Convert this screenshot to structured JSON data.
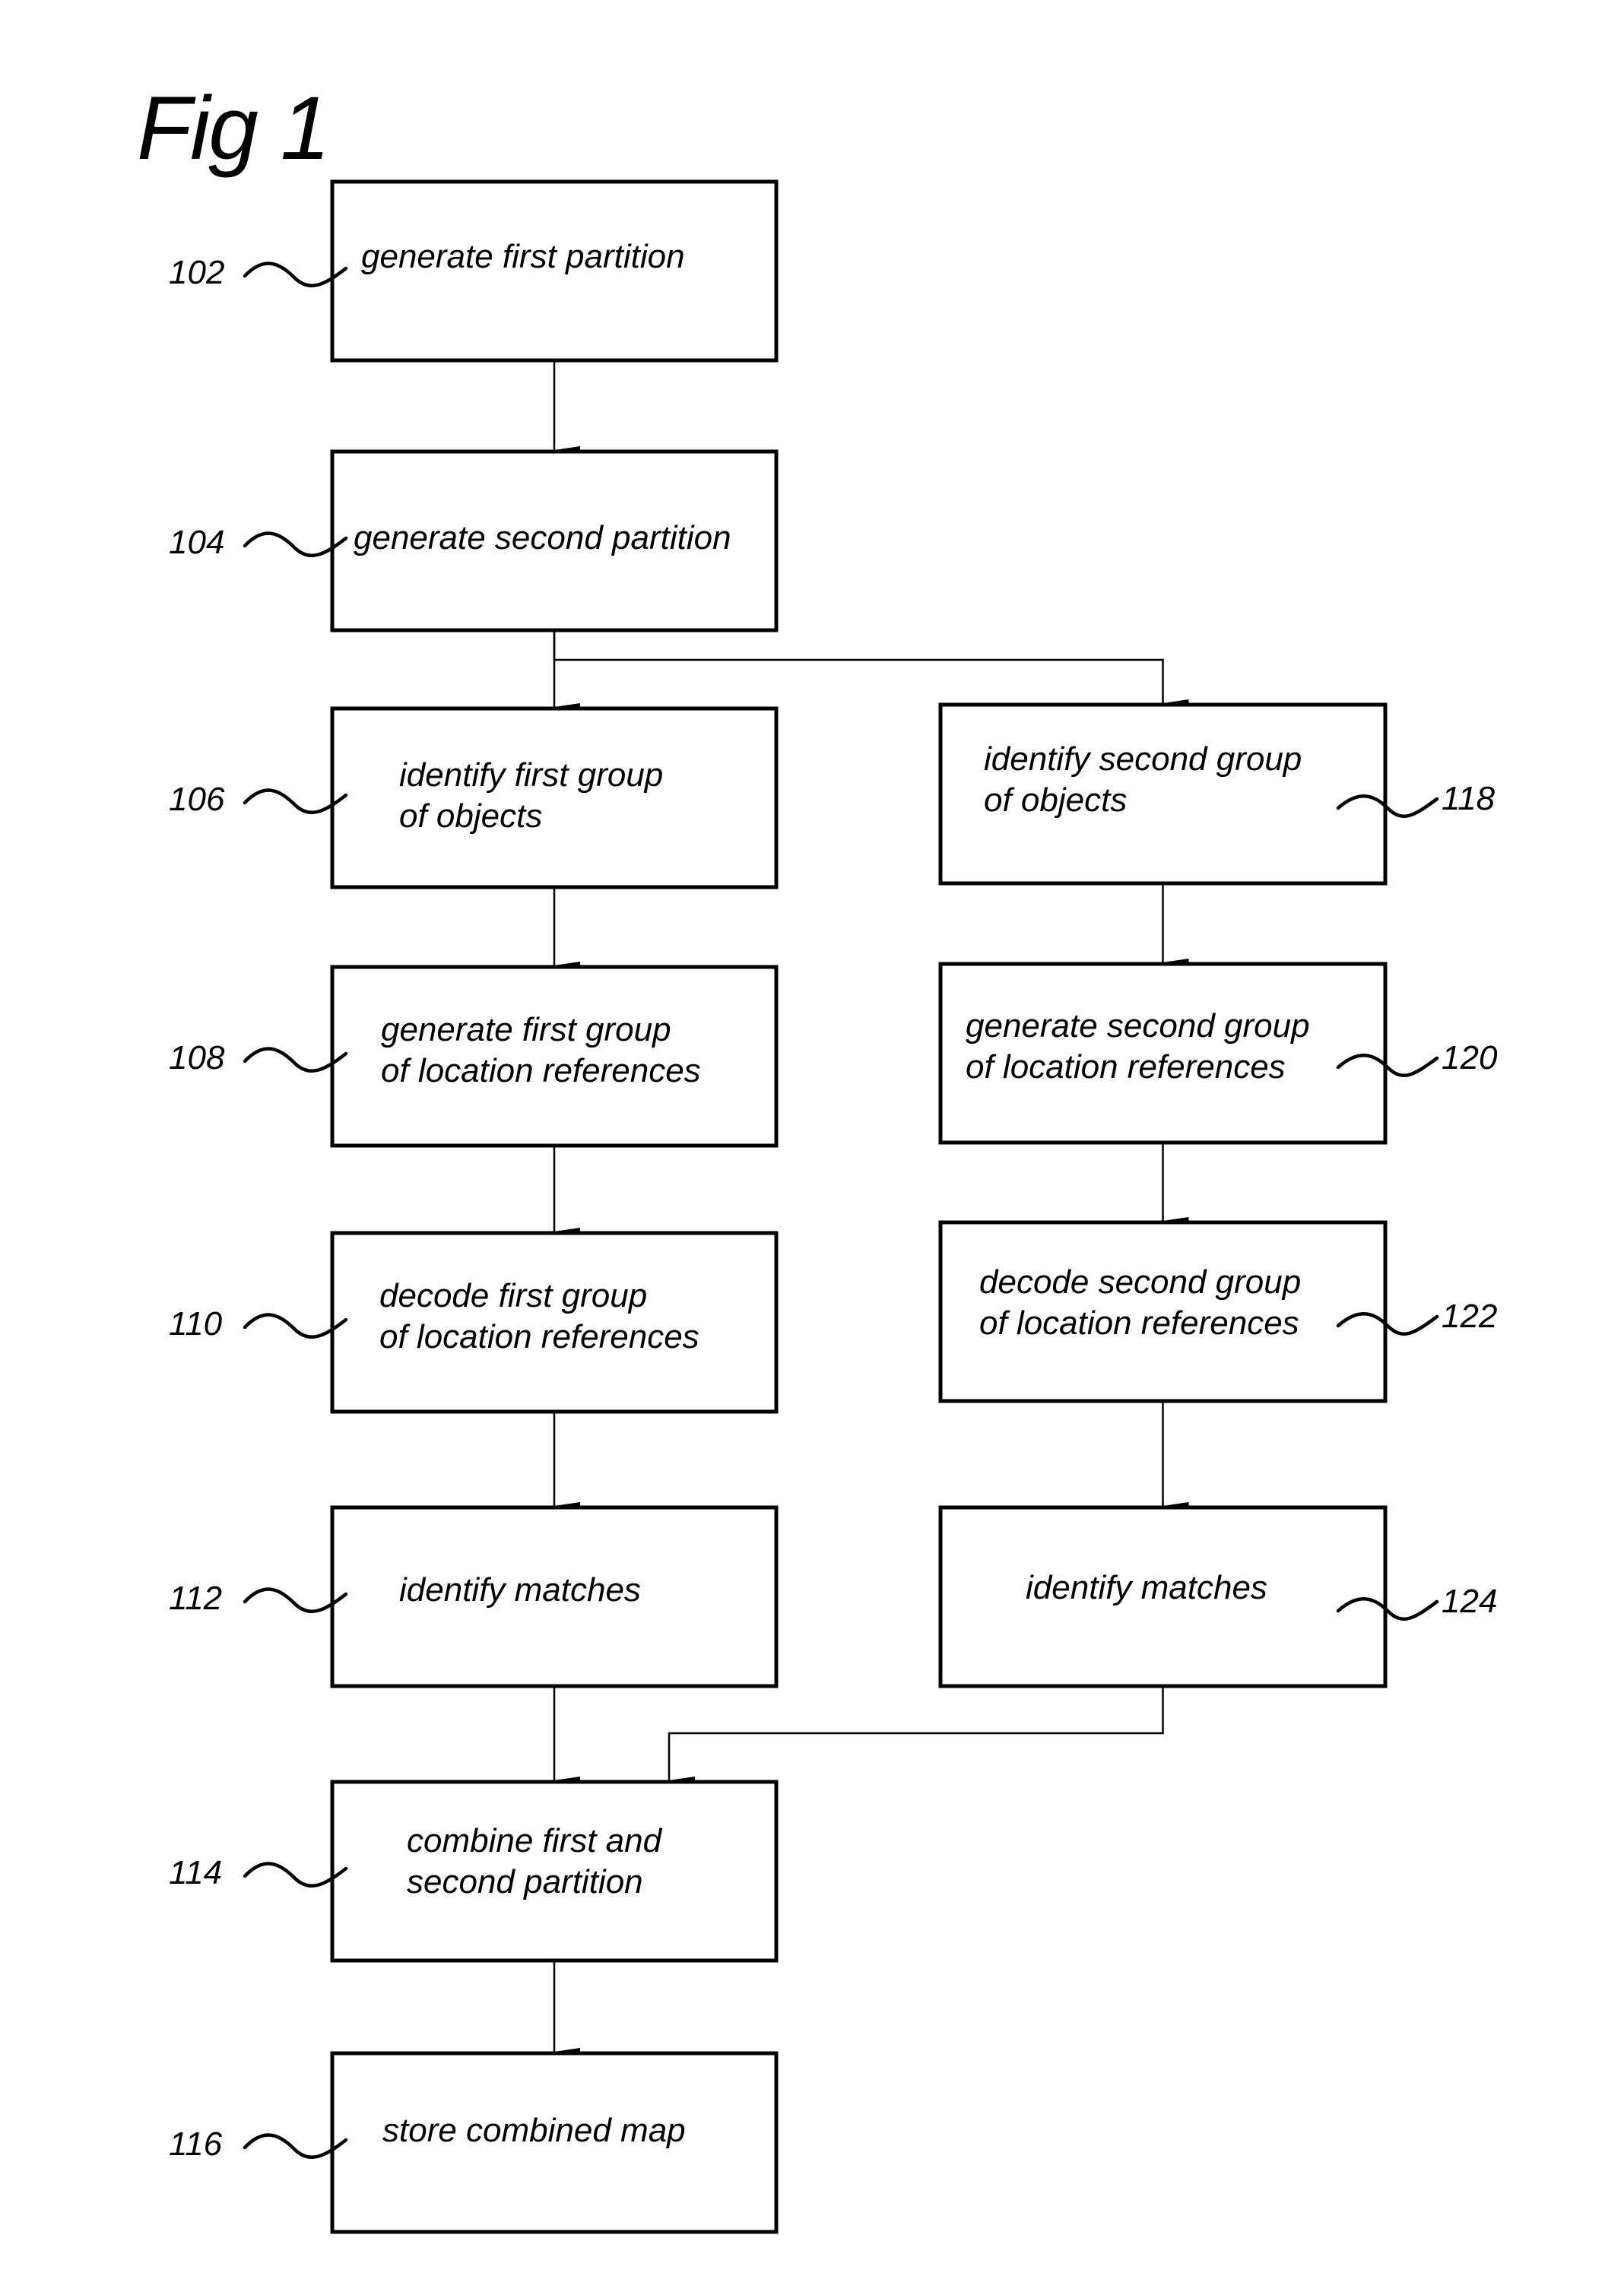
{
  "figure": {
    "title": "Fig 1"
  },
  "steps": [
    {
      "ref": "102",
      "lines": [
        "generate first partition"
      ],
      "column": "left"
    },
    {
      "ref": "104",
      "lines": [
        "generate second partition"
      ],
      "column": "left"
    },
    {
      "ref": "106",
      "lines": [
        "identify first group",
        "of objects"
      ],
      "column": "left"
    },
    {
      "ref": "108",
      "lines": [
        "generate first group",
        "of location references"
      ],
      "column": "left"
    },
    {
      "ref": "110",
      "lines": [
        "decode first group",
        "of location references"
      ],
      "column": "left"
    },
    {
      "ref": "112",
      "lines": [
        "identify matches"
      ],
      "column": "left"
    },
    {
      "ref": "114",
      "lines": [
        "combine first and",
        "second partition"
      ],
      "column": "left"
    },
    {
      "ref": "116",
      "lines": [
        "store combined map"
      ],
      "column": "left"
    },
    {
      "ref": "118",
      "lines": [
        "identify second group",
        "of objects"
      ],
      "column": "right"
    },
    {
      "ref": "120",
      "lines": [
        "generate second group",
        "of location references"
      ],
      "column": "right"
    },
    {
      "ref": "122",
      "lines": [
        "decode second group",
        "of location references"
      ],
      "column": "right"
    },
    {
      "ref": "124",
      "lines": [
        "identify matches"
      ],
      "column": "right"
    }
  ],
  "connections": [
    {
      "from": "102",
      "to": "104"
    },
    {
      "from": "104",
      "to": "106"
    },
    {
      "from": "104",
      "to": "118"
    },
    {
      "from": "106",
      "to": "108"
    },
    {
      "from": "108",
      "to": "110"
    },
    {
      "from": "110",
      "to": "112"
    },
    {
      "from": "112",
      "to": "114"
    },
    {
      "from": "114",
      "to": "116"
    },
    {
      "from": "118",
      "to": "120"
    },
    {
      "from": "120",
      "to": "122"
    },
    {
      "from": "122",
      "to": "124"
    },
    {
      "from": "124",
      "to": "114"
    }
  ]
}
